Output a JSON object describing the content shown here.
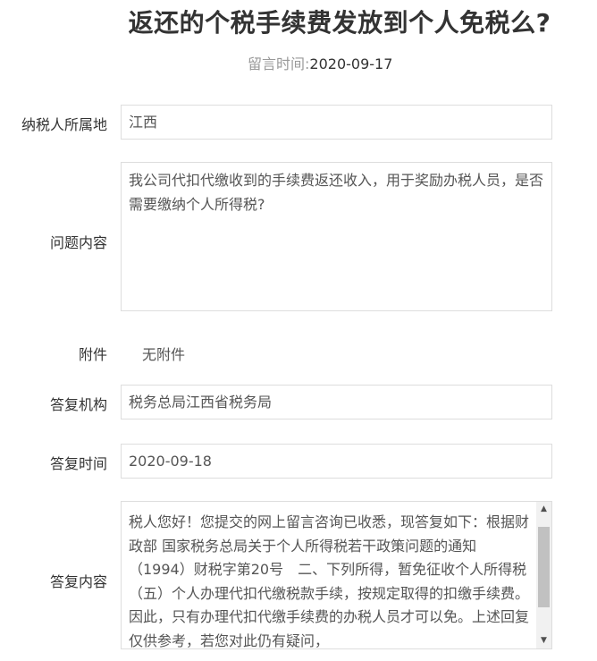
{
  "title": "返还的个税手续费发放到个人免税么?",
  "meta": {
    "label": "留言时间:",
    "value": "2020-09-17"
  },
  "fields": {
    "location": {
      "label": "纳税人所属地",
      "value": "江西"
    },
    "question": {
      "label": "问题内容",
      "value": "我公司代扣代缴收到的手续费返还收入，用于奖励办税人员，是否需要缴纳个人所得税?"
    },
    "attachment": {
      "label": "附件",
      "value": "无附件"
    },
    "org": {
      "label": "答复机构",
      "value": "税务总局江西省税务局"
    },
    "time": {
      "label": "答复时间",
      "value": "2020-09-18"
    },
    "answer": {
      "label": "答复内容",
      "value": "税人您好！您提交的网上留言咨询已收悉，现答复如下：根据财政部 国家税务总局关于个人所得税若干政策问题的通知 （1994）财税字第20号　二、下列所得，暂免征收个人所得税 （五）个人办理代扣代缴税款手续，按规定取得的扣缴手续费。因此，只有办理代扣代缴手续费的办税人员才可以免。上述回复仅供参考，若您对此仍有疑问，"
    }
  }
}
